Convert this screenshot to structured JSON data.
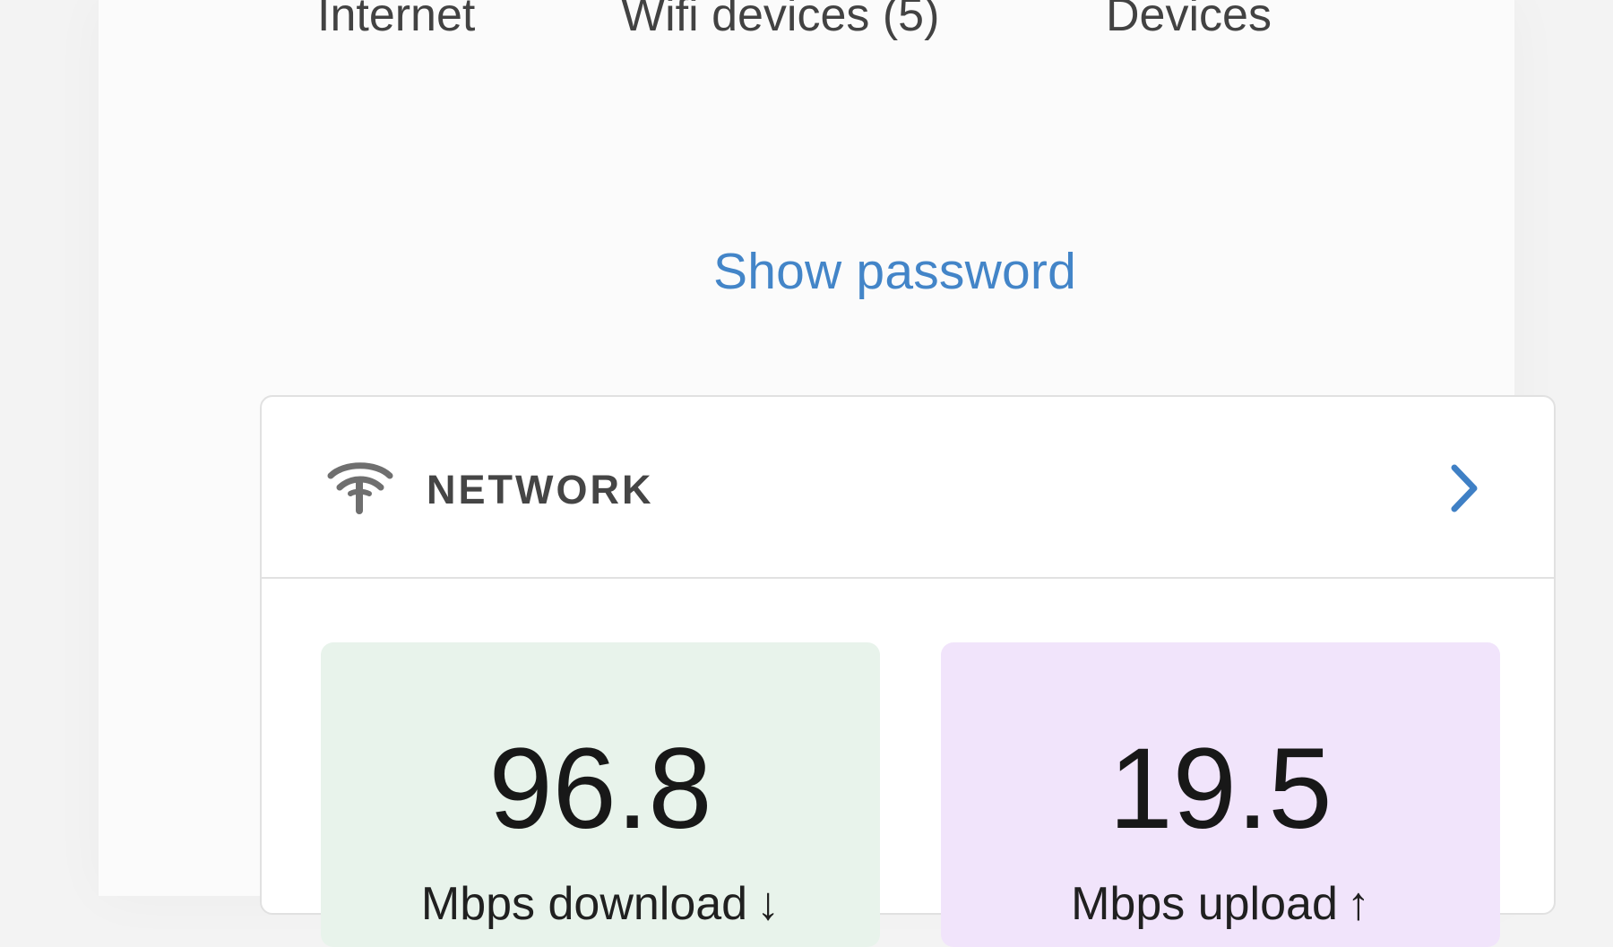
{
  "tabs": [
    {
      "label": "Internet"
    },
    {
      "label": "Wifi devices (5)"
    },
    {
      "label": "Devices"
    }
  ],
  "show_password_link": "Show password",
  "network_card": {
    "icon": "network-icon",
    "title": "NETWORK",
    "chevron_icon": "chevron-right-icon"
  },
  "speed": {
    "download": {
      "value": "96.8",
      "label": "Mbps download",
      "arrow": "↓"
    },
    "upload": {
      "value": "19.5",
      "label": "Mbps upload",
      "arrow": "↑"
    }
  },
  "colors": {
    "link_blue": "#4385c8",
    "download_tile": "#e8f3eb",
    "upload_tile": "#f1e4fb",
    "text_dark": "#181818"
  }
}
